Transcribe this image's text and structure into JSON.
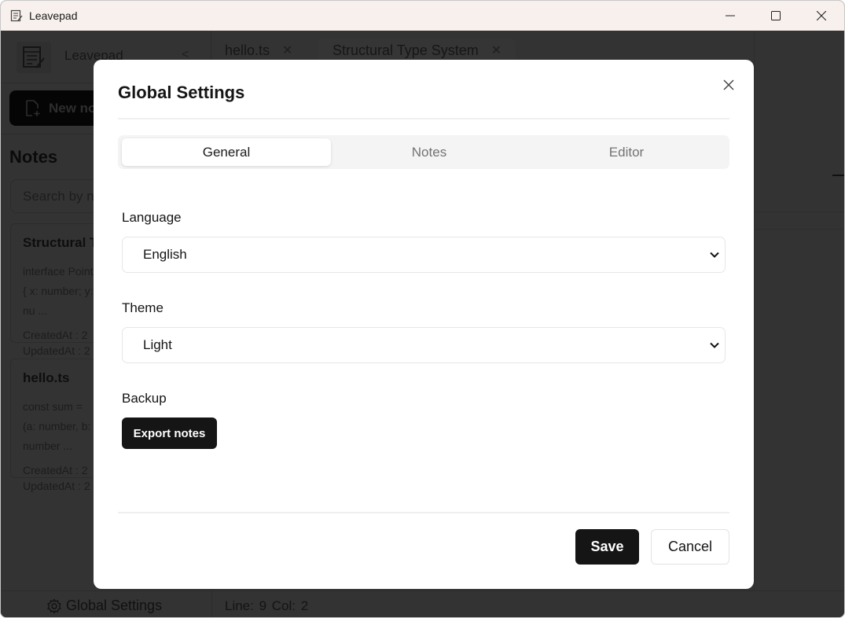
{
  "window": {
    "title": "Leavepad",
    "controls": {
      "minimize": "minimize-icon",
      "maximize": "maximize-icon",
      "close": "close-icon"
    }
  },
  "sidebar": {
    "brand_name": "Leavepad",
    "collapse_glyph": "<",
    "new_note_label": "New note",
    "notes_heading": "Notes",
    "search_placeholder": "Search by name",
    "notes": [
      {
        "title": "Structural Type System",
        "preview": "interface Point { x: number; y: nu ...",
        "created": "CreatedAt : 2",
        "updated": "UpdatedAt : 2"
      },
      {
        "title": "hello.ts",
        "preview": "const sum = (a: number, b: number ...",
        "created": "CreatedAt : 2",
        "updated": "UpdatedAt : 2"
      }
    ]
  },
  "tabs": [
    {
      "label": "hello.ts",
      "active": false
    },
    {
      "label": "Structural Type System",
      "active": true
    }
  ],
  "status": {
    "settings_label": "Global Settings",
    "position": "Line: 9  Col: 2"
  },
  "modal": {
    "title": "Global Settings",
    "tabs": [
      "General",
      "Notes",
      "Editor"
    ],
    "active_tab": "General",
    "language": {
      "label": "Language",
      "value": "English"
    },
    "theme": {
      "label": "Theme",
      "value": "Light"
    },
    "backup": {
      "label": "Backup",
      "button": "Export notes"
    },
    "save_label": "Save",
    "cancel_label": "Cancel"
  }
}
